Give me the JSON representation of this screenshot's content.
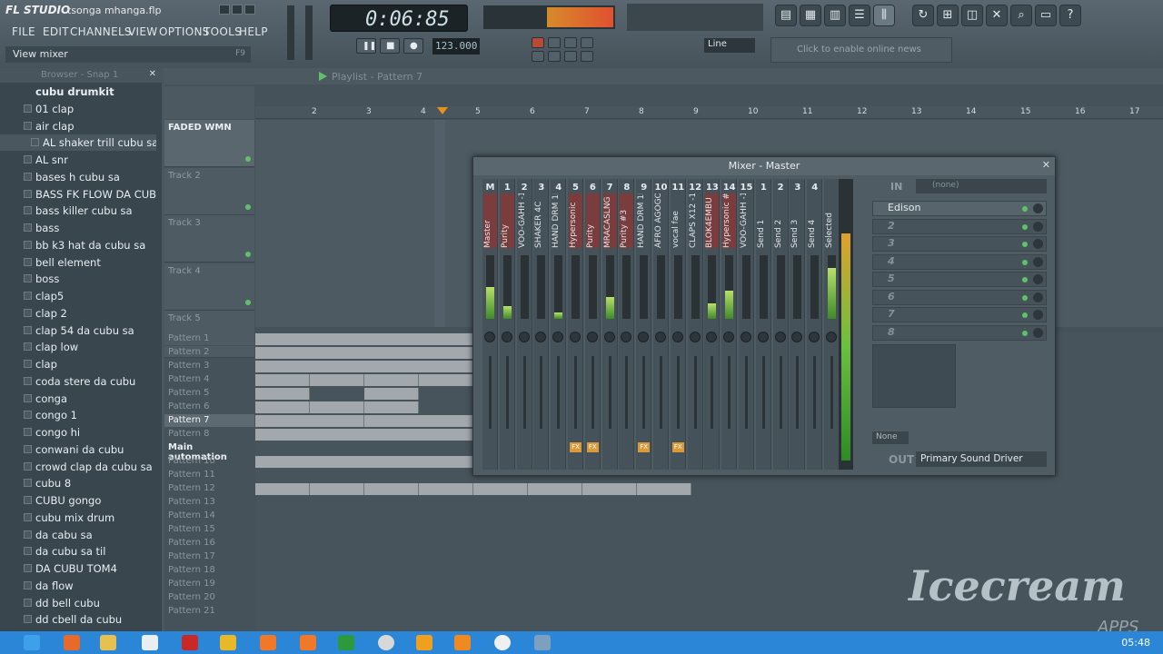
{
  "app": {
    "logo": "FL STUDIO",
    "project": "tsonga mhanga.flp"
  },
  "menu": [
    "FILE",
    "EDIT",
    "CHANNELS",
    "VIEW",
    "OPTIONS",
    "TOOLS",
    "HELP"
  ],
  "hint": {
    "text": "View mixer",
    "key": "F9"
  },
  "transport": {
    "time": "0:06:85",
    "tempo": "123.000",
    "snap": "Line"
  },
  "news": "Click to enable online news",
  "browser": {
    "title": "Browser - Snap 1",
    "items": [
      "cubu drumkit",
      "01 clap",
      "air clap",
      "AL shaker trill cubu sa",
      "AL snr",
      "bases h cubu sa",
      "BASS FK FLOW DA CUB...",
      "bass killer cubu sa",
      "bass",
      "bb k3 hat da cubu sa",
      "bell element",
      "boss",
      "clap5",
      "clap 2",
      "clap 54 da cubu sa",
      "clap low",
      "clap",
      "coda stere da cubu",
      "conga",
      "congo 1",
      "congo hi",
      "conwani da cubu",
      "crowd clap da cubu sa",
      "cubu 8",
      "CUBU gongo",
      "cubu mix drum",
      "da cabu sa",
      "da cubu sa til",
      "DA CUBU TOM4",
      "da flow",
      "dd bell cubu",
      "dd cbell da cubu"
    ]
  },
  "playlist": {
    "title": "Playlist - Pattern 7",
    "ruler": [
      "2",
      "3",
      "4",
      "5",
      "6",
      "7",
      "8",
      "9",
      "10",
      "11",
      "12",
      "13",
      "14",
      "15",
      "16",
      "17"
    ],
    "tracks": [
      "FADED WMN",
      "Track 2",
      "Track 3",
      "Track 4",
      "Track 5"
    ],
    "patterns": [
      "Pattern 1",
      "Pattern 2",
      "Pattern 3",
      "Pattern 4",
      "Pattern 5",
      "Pattern 6",
      "Pattern 7",
      "Pattern 8",
      "Main automation",
      "Pattern 10",
      "Pattern 11",
      "Pattern 12",
      "Pattern 13",
      "Pattern 14",
      "Pattern 15",
      "Pattern 16",
      "Pattern 17",
      "Pattern 18",
      "Pattern 19",
      "Pattern 20",
      "Pattern 21"
    ]
  },
  "mixer": {
    "title": "Mixer - Master",
    "strips": [
      {
        "num": "M",
        "label": "Master",
        "level": 0.5,
        "red": true
      },
      {
        "num": "1",
        "label": "Purity",
        "level": 0.2,
        "red": true
      },
      {
        "num": "2",
        "label": "VOO-GAHH -1",
        "level": 0,
        "red": false
      },
      {
        "num": "3",
        "label": "SHAKER 4C",
        "level": 0,
        "red": false
      },
      {
        "num": "4",
        "label": "HAND DRM 1I",
        "level": 0.1,
        "red": false
      },
      {
        "num": "5",
        "label": "Hypersonic",
        "level": 0,
        "red": true
      },
      {
        "num": "6",
        "label": "Purity",
        "level": 0,
        "red": true
      },
      {
        "num": "7",
        "label": "MRACASLNG",
        "level": 0.35,
        "red": true
      },
      {
        "num": "8",
        "label": "Purity #3",
        "level": 0,
        "red": true
      },
      {
        "num": "9",
        "label": "HAND DRM 1I",
        "level": 0,
        "red": false
      },
      {
        "num": "10",
        "label": "AFRO AGOGO",
        "level": 0,
        "red": false
      },
      {
        "num": "11",
        "label": "vocal fae",
        "level": 0,
        "red": false
      },
      {
        "num": "12",
        "label": "CLAPS X12 -1",
        "level": 0,
        "red": false
      },
      {
        "num": "13",
        "label": "BLOK4EMBU",
        "level": 0.25,
        "red": true
      },
      {
        "num": "14",
        "label": "Hypersonic #2",
        "level": 0.45,
        "red": true
      },
      {
        "num": "15",
        "label": "VOO-GAHH -1",
        "level": 0,
        "red": false
      },
      {
        "num": "1",
        "label": "Send 1",
        "level": 0,
        "red": false
      },
      {
        "num": "2",
        "label": "Send 2",
        "level": 0,
        "red": false
      },
      {
        "num": "3",
        "label": "Send 3",
        "level": 0,
        "red": false
      },
      {
        "num": "4",
        "label": "Send 4",
        "level": 0,
        "red": false
      },
      {
        "num": "",
        "label": "Selected",
        "level": 0.8,
        "red": false
      }
    ],
    "fx_strips": [
      5,
      6,
      9,
      11
    ],
    "in": {
      "label": "IN",
      "value": "(none)"
    },
    "slots": [
      "Edison",
      "2",
      "3",
      "4",
      "5",
      "6",
      "7",
      "8"
    ],
    "out": {
      "label": "OUT",
      "value": "Primary Sound Driver"
    },
    "eq_none": "None"
  },
  "taskbar": {
    "time": "05:48"
  },
  "watermark": {
    "brand": "Icecream",
    "sub": "APPS"
  }
}
